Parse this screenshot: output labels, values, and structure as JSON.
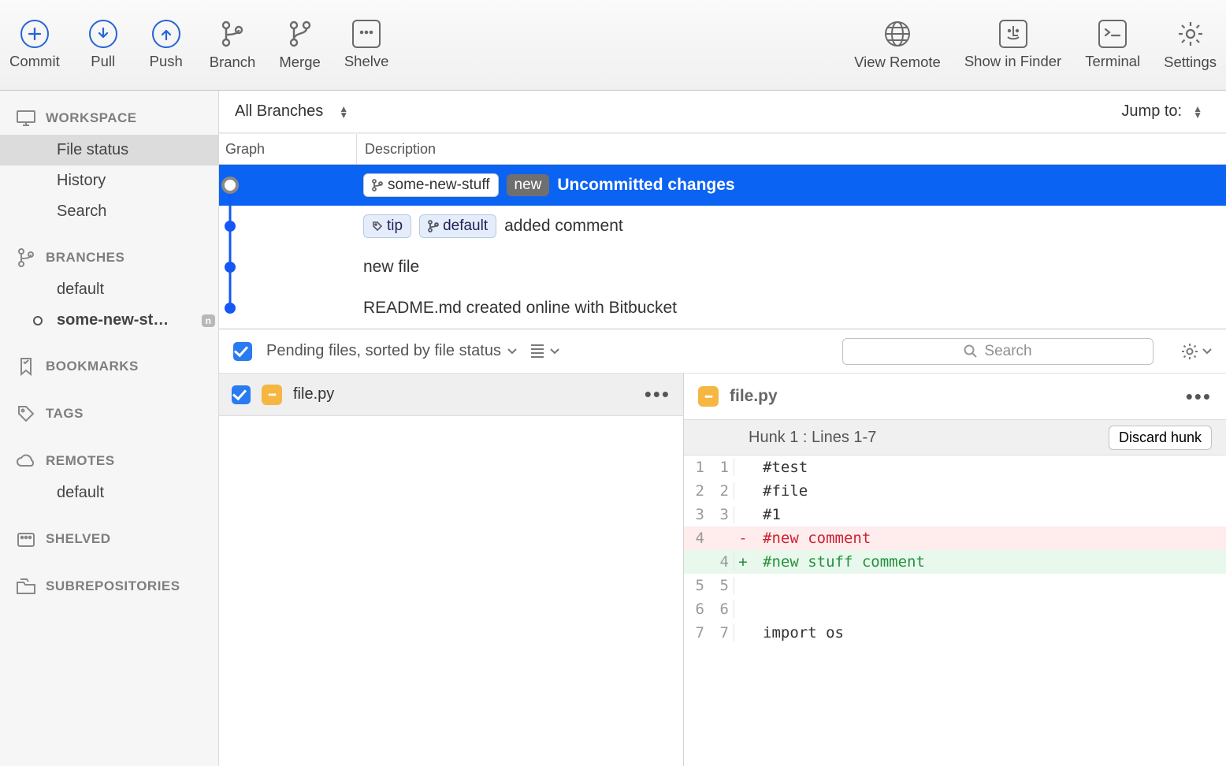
{
  "toolbar": {
    "commit": "Commit",
    "pull": "Pull",
    "push": "Push",
    "branch": "Branch",
    "merge": "Merge",
    "shelve": "Shelve",
    "view_remote": "View Remote",
    "show_in_finder": "Show in Finder",
    "terminal": "Terminal",
    "settings": "Settings"
  },
  "sidebar": {
    "workspace": {
      "label": "WORKSPACE",
      "items": [
        "File status",
        "History",
        "Search"
      ]
    },
    "branches": {
      "label": "BRANCHES",
      "items": [
        "default",
        "some-new-st…"
      ],
      "new_badge": "n"
    },
    "bookmarks": {
      "label": "BOOKMARKS"
    },
    "tags": {
      "label": "TAGS"
    },
    "remotes": {
      "label": "REMOTES",
      "items": [
        "default"
      ]
    },
    "shelved": {
      "label": "SHELVED"
    },
    "subrepos": {
      "label": "SUBREPOSITORIES"
    }
  },
  "filter": {
    "branch_selector": "All Branches",
    "jump_label": "Jump to:"
  },
  "list_header": {
    "graph": "Graph",
    "description": "Description"
  },
  "commits": [
    {
      "branch_pill": "some-new-stuff",
      "new_tag": "new",
      "message": "Uncommitted changes",
      "selected": true
    },
    {
      "tip_tag": "tip",
      "branch_pill": "default",
      "message": "added comment"
    },
    {
      "message": "new file"
    },
    {
      "message": "README.md created online with Bitbucket"
    }
  ],
  "colors": {
    "accent": "#0b63f3",
    "graph": "#1557f5"
  },
  "bottom": {
    "pending_label": "Pending files, sorted by file status",
    "search_placeholder": "Search",
    "file": {
      "name": "file.py"
    },
    "hunk_label": "Hunk 1 : Lines 1-7",
    "discard_label": "Discard hunk",
    "diff": [
      {
        "old": "1",
        "new": "1",
        "mark": "",
        "text": "#test"
      },
      {
        "old": "2",
        "new": "2",
        "mark": "",
        "text": "#file"
      },
      {
        "old": "3",
        "new": "3",
        "mark": "",
        "text": "#1"
      },
      {
        "old": "4",
        "new": "",
        "mark": "-",
        "text": "#new comment",
        "type": "del"
      },
      {
        "old": "",
        "new": "4",
        "mark": "+",
        "text": "#new stuff comment",
        "type": "add"
      },
      {
        "old": "5",
        "new": "5",
        "mark": "",
        "text": ""
      },
      {
        "old": "6",
        "new": "6",
        "mark": "",
        "text": ""
      },
      {
        "old": "7",
        "new": "7",
        "mark": "",
        "text": "import os"
      }
    ]
  }
}
